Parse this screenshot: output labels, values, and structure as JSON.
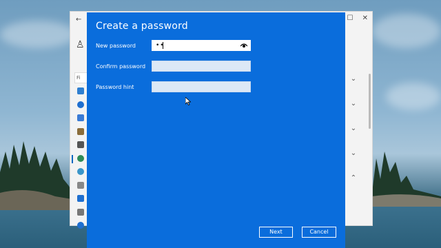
{
  "dialog": {
    "title": "Create a password",
    "fields": [
      {
        "label": "New password",
        "value": "••",
        "state": "active"
      },
      {
        "label": "Confirm password",
        "value": "",
        "state": "inactive"
      },
      {
        "label": "Password hint",
        "value": "",
        "state": "inactive"
      }
    ],
    "buttons": {
      "next": "Next",
      "cancel": "Cancel"
    }
  },
  "background_window": {
    "search_placeholder": "Fi",
    "back_icon": "back-arrow-icon",
    "nav_icons": [
      "display-icon",
      "bluetooth-icon",
      "network-icon",
      "personalization-icon",
      "apps-icon",
      "accounts-icon",
      "time-language-icon",
      "gaming-icon",
      "accessibility-icon",
      "privacy-icon",
      "update-icon"
    ]
  },
  "colors": {
    "dialog_blue": "#0a6ddc",
    "active_field": "#ffffff",
    "inactive_field": "#dce8f6"
  }
}
